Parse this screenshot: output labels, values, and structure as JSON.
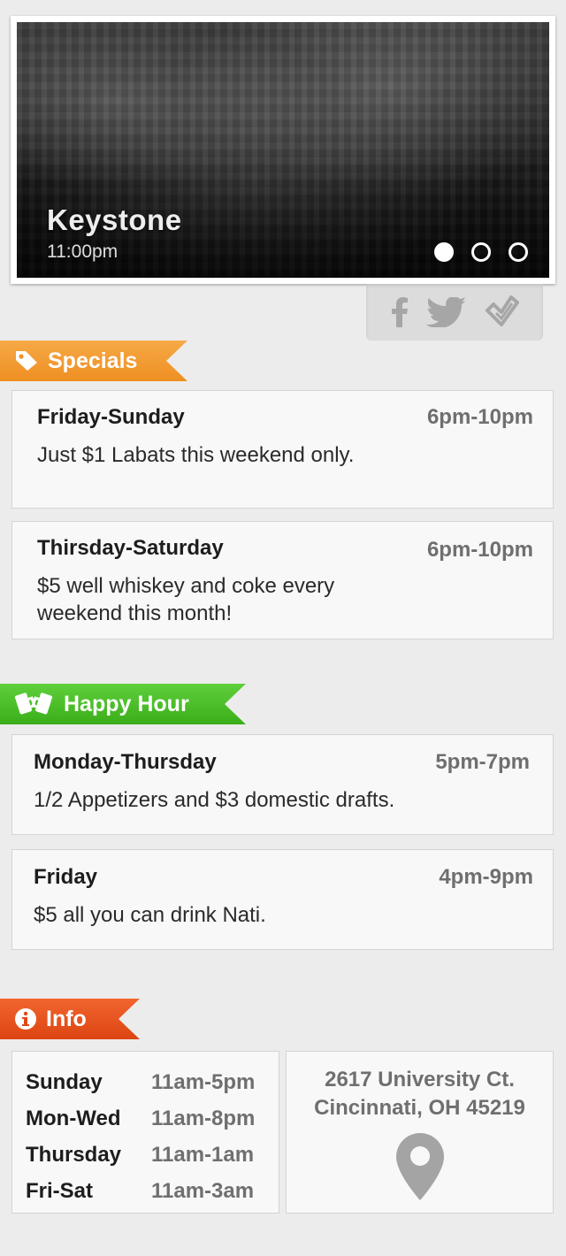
{
  "hero": {
    "title": "Keystone",
    "time": "11:00pm",
    "slides": 3,
    "active_slide": 1
  },
  "social": {
    "icons": [
      "facebook-icon",
      "twitter-icon",
      "foursquare-icon"
    ]
  },
  "specials": {
    "heading": "Specials",
    "accent": "#ee8f22",
    "items": [
      {
        "days": "Friday-Sunday",
        "time": "6pm-10pm",
        "description": "Just $1 Labats this weekend only."
      },
      {
        "days": "Thirsday-Saturday",
        "time": "6pm-10pm",
        "description": "$5 well whiskey and coke every weekend this month!"
      }
    ]
  },
  "happy_hour": {
    "heading": "Happy Hour",
    "accent": "#3aae1a",
    "items": [
      {
        "days": "Monday-Thursday",
        "time": "5pm-7pm",
        "description": "1/2 Appetizers and $3 domestic drafts."
      },
      {
        "days": "Friday",
        "time": "4pm-9pm",
        "description": "$5 all you can drink Nati."
      }
    ]
  },
  "info": {
    "heading": "Info",
    "accent": "#dc4512",
    "hours": [
      {
        "day": "Sunday",
        "time": "11am-5pm"
      },
      {
        "day": "Mon-Wed",
        "time": "11am-8pm"
      },
      {
        "day": "Thursday",
        "time": "11am-1am"
      },
      {
        "day": "Fri-Sat",
        "time": "11am-3am"
      }
    ],
    "address_line1": "2617 University Ct.",
    "address_line2": "Cincinnati, OH 45219"
  }
}
